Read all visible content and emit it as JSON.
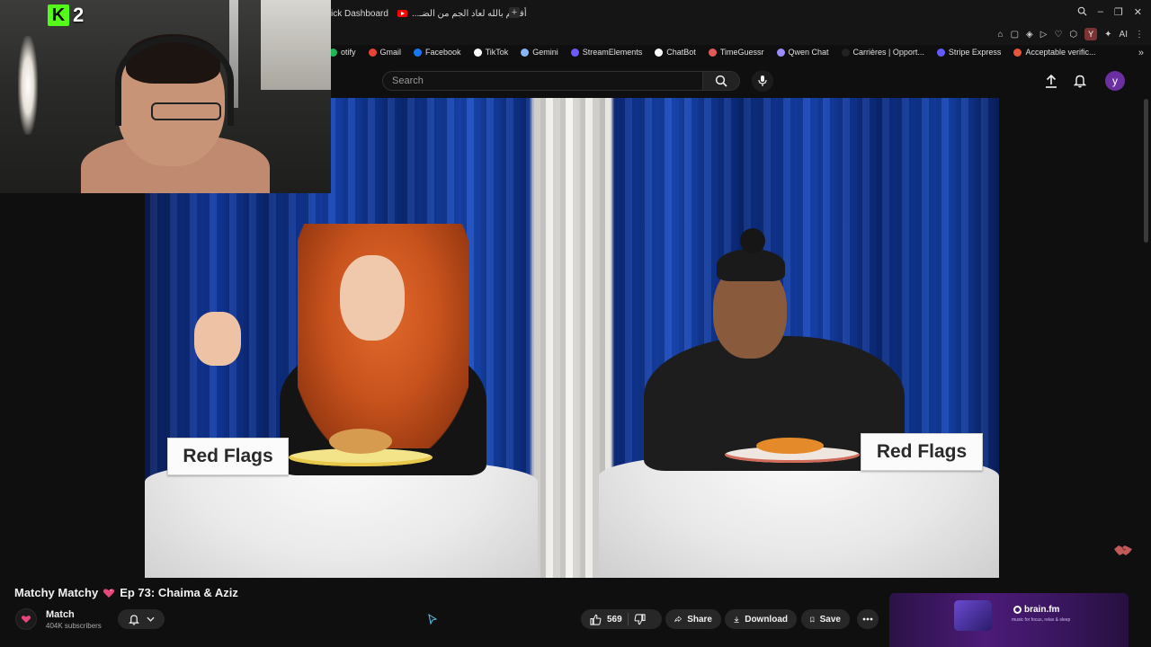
{
  "browser": {
    "tabs": [
      {
        "label": "ick Dashboard",
        "active": false
      },
      {
        "label": "أقسم بالله لعاد الجم من الضـ...",
        "active": true
      }
    ],
    "new_tab": "+",
    "window_controls": {
      "minimize": "–",
      "restore": "❐",
      "close": "✕"
    },
    "extensions": {
      "profile_letter": "Y",
      "ai_label": "AI"
    },
    "bookmarks": [
      {
        "label": "otify",
        "color": "#1db954"
      },
      {
        "label": "Gmail",
        "color": "#ea4335"
      },
      {
        "label": "Facebook",
        "color": "#1877f2"
      },
      {
        "label": "TikTok",
        "color": "#ffffff"
      },
      {
        "label": "Gemini",
        "color": "#8ab4f8"
      },
      {
        "label": "StreamElements",
        "color": "#6b5bff"
      },
      {
        "label": "ChatBot",
        "color": "#ffffff"
      },
      {
        "label": "TimeGuessr",
        "color": "#e05a5a"
      },
      {
        "label": "Qwen Chat",
        "color": "#9b8cff"
      },
      {
        "label": "Carrières | Opport...",
        "color": "#222222"
      },
      {
        "label": "Stripe Express",
        "color": "#635bff"
      },
      {
        "label": "Acceptable verific...",
        "color": "#e8553a"
      }
    ],
    "bookmarks_more": "»"
  },
  "youtube": {
    "search": {
      "placeholder": "Search",
      "value": ""
    },
    "avatar_letter": "y"
  },
  "stream_overlay": {
    "platform": "K",
    "viewer_count": "2"
  },
  "video": {
    "sign_left": "Red Flags",
    "sign_right": "Red Flags",
    "title_before": "Matchy Matchy",
    "title_after": "Ep 73: Chaima & Aziz",
    "channel": {
      "name": "Match",
      "subscribers": "404K subscribers"
    },
    "actions": {
      "likes": "569",
      "share": "Share",
      "download": "Download",
      "save": "Save"
    }
  },
  "ad": {
    "brand": "brain.fm",
    "tagline": "music for focus, relax & sleep"
  },
  "colors": {
    "kick_green": "#53fc18",
    "avatar_purple": "#6a2fa0",
    "youtube_red": "#ff0000"
  }
}
